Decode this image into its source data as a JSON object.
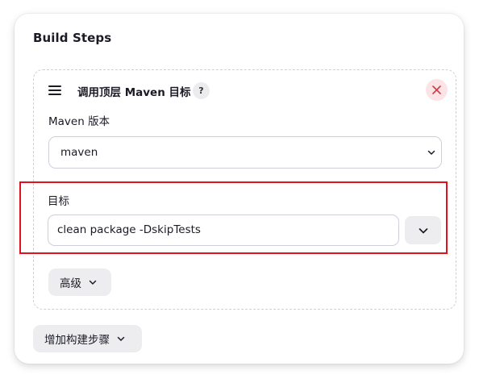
{
  "section": {
    "title": "Build Steps"
  },
  "step": {
    "title": "调用顶层 Maven 目标",
    "help_glyph": "?",
    "close_icon": "close-icon",
    "drag_icon": "drag-handle-icon"
  },
  "maven_version": {
    "label": "Maven 版本",
    "selected": "maven"
  },
  "goals": {
    "label": "目标",
    "value": "clean package -DskipTests",
    "expand_icon": "chevron-down-icon"
  },
  "advanced": {
    "label": "高级"
  },
  "add_step": {
    "label": "增加构建步骤"
  },
  "colors": {
    "highlight": "#e1121d",
    "close_bg": "#fbe3e6",
    "close_fg": "#d33a4a",
    "button_bg": "#ededf0"
  }
}
